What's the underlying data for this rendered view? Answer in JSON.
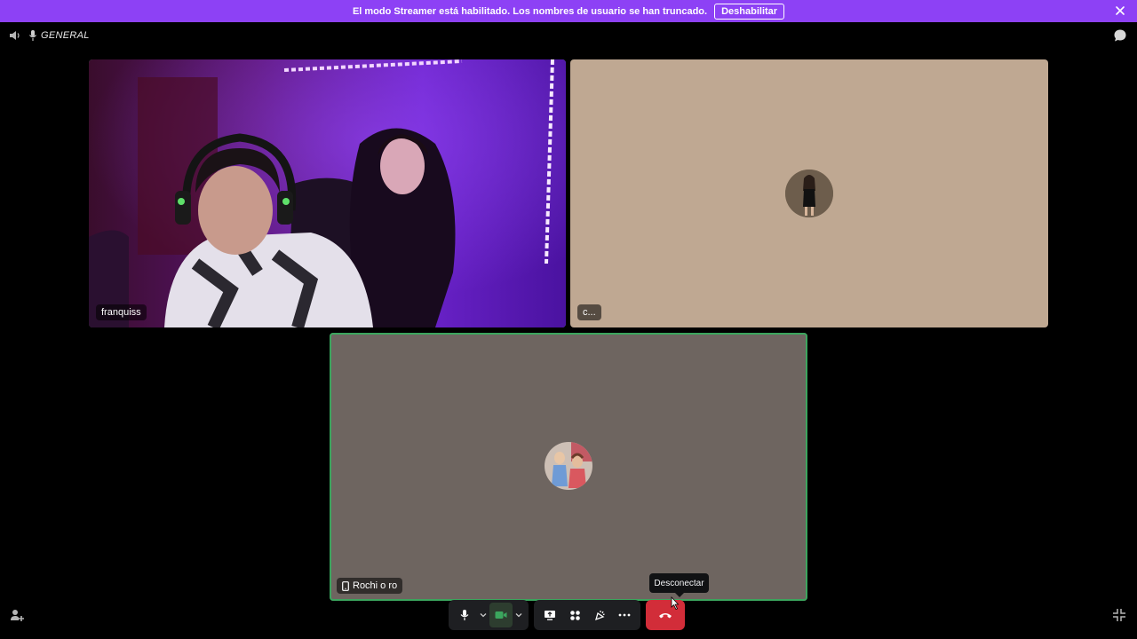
{
  "banner": {
    "message": "El modo Streamer está habilitado. Los nombres de usuario se han truncado.",
    "disable_label": "Deshabilitar"
  },
  "channel": {
    "name": "GENERAL"
  },
  "participants": [
    {
      "name": "franquiss",
      "video": "camera"
    },
    {
      "name": "c...",
      "video": "avatar"
    },
    {
      "name": "Rochi o ro",
      "video": "avatar",
      "device_icon": "phone-icon"
    }
  ],
  "controls": {
    "disconnect_tooltip": "Desconectar"
  },
  "colors": {
    "banner": "#8d41f5",
    "speaking_border": "#3ba55d",
    "disconnect": "#d22d39",
    "tile_c_bg": "#bfa892",
    "tile_rochi_bg": "#6e6560"
  }
}
